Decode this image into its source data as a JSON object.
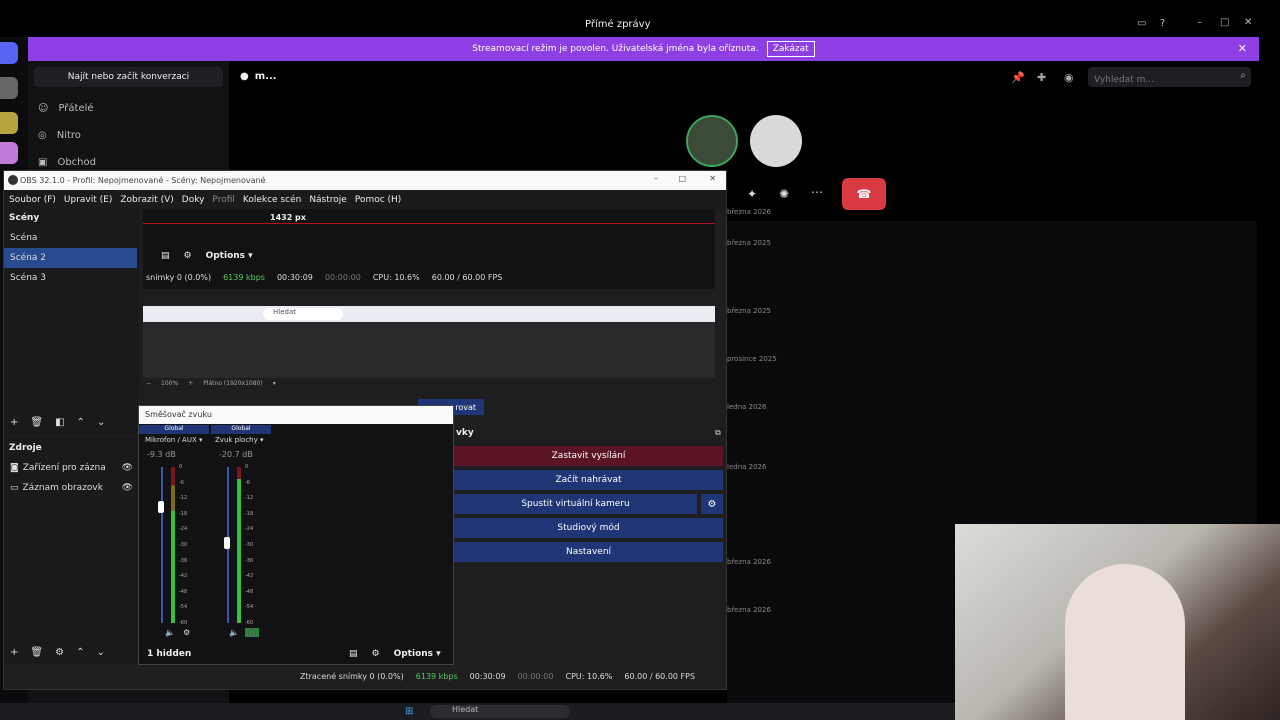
{
  "discord": {
    "title": "Přímé zprávy",
    "banner": {
      "text": "Streamovací režim je povolen. Uživatelská jména byla oříznuta.",
      "button": "Zakázat"
    },
    "search_conversation": "Najít nebo začít konverzaci",
    "nav": [
      {
        "label": "Přátelé",
        "icon": "friends-icon"
      },
      {
        "label": "Nitro",
        "icon": "nitro-icon"
      },
      {
        "label": "Obchod",
        "icon": "shop-icon"
      }
    ],
    "dm_name": "m...",
    "search_placeholder": "Vyhledat m...",
    "dates": [
      "března 2026",
      "března 2025",
      "března 2025",
      "prosince 2025",
      "ledna 2026",
      "ledna 2026",
      "března 2026",
      "března 2026"
    ]
  },
  "obs": {
    "title": "OBS 32.1.0 - Profil: Nepojmenované - Scény: Nepojmenované",
    "menu": [
      "Soubor (F)",
      "Upravit (E)",
      "Zobrazit (V)",
      "Doky",
      "Profil",
      "Kolekce scén",
      "Nástroje",
      "Pomoc (H)"
    ],
    "scenes_header": "Scény",
    "scenes": [
      "Scéna",
      "Scéna 2",
      "Scéna 3"
    ],
    "sources_header": "Zdroje",
    "sources": [
      "Zařízení pro zázna",
      "Záznam obrazovk"
    ],
    "px_label": "1432 px",
    "options": "Options",
    "status": {
      "dropped": "snímky 0 (0.0%)",
      "dropped_full": "Ztracené snímky 0 (0.0%)",
      "kbps": "6139 kbps",
      "time1": "00:30:09",
      "time2": "00:00:00",
      "cpu": "CPU: 10.6%",
      "fps": "60.00 / 60.00 FPS"
    },
    "zoom": "100%",
    "canvas_label": "Plátno (1920x1080)",
    "search_label": "Hledat",
    "controls_header": "vky",
    "controls": [
      "Zastavit vysílání",
      "Začít nahrávat",
      "Spustit virtuální kameru",
      "Studiový mód",
      "Nastavení"
    ],
    "mixer": {
      "title": "Směšovač zvuku",
      "channels": [
        {
          "global": "Global",
          "name": "Mikrofon / AUX",
          "db": "-9.3 dB",
          "level": 0.72,
          "fader": 0.78
        },
        {
          "global": "Global",
          "name": "Zvuk plochy",
          "db": "-20.7 dB",
          "level": 0.92,
          "fader": 0.55
        }
      ],
      "ticks": [
        "0",
        "-6",
        "-12",
        "-18",
        "-24",
        "-30",
        "-36",
        "-42",
        "-48",
        "-54",
        "-60"
      ],
      "hidden": "1 hidden"
    },
    "rovat": "rovat"
  },
  "colors": {
    "accent": "#8d3fe4",
    "obs_blue": "#1f3576",
    "stop_red": "#5a1424",
    "call_red": "#d83a42"
  }
}
